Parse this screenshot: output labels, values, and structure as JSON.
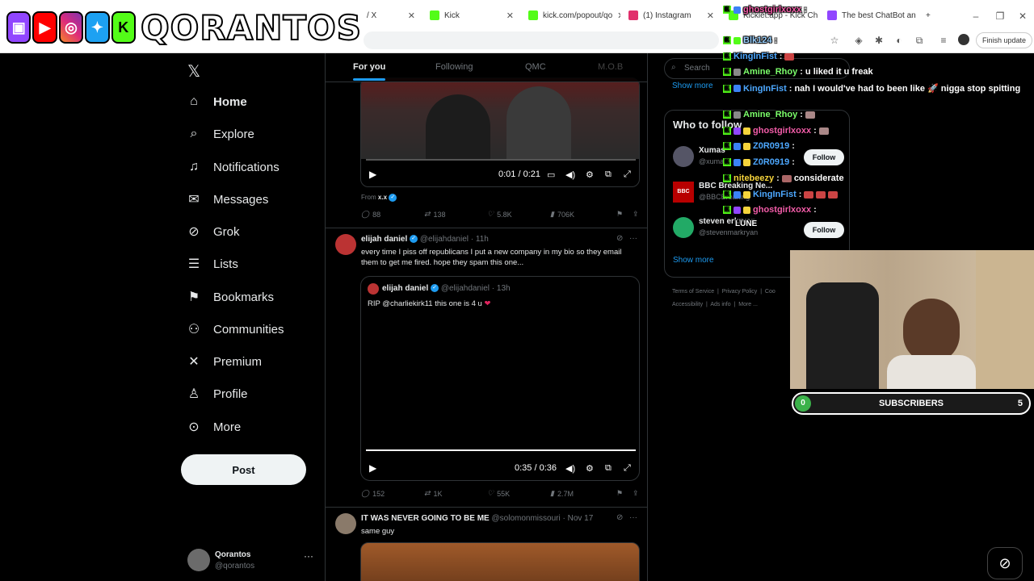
{
  "browser": {
    "tabs": [
      {
        "title": "/ X",
        "color": "#000000"
      },
      {
        "title": "Kick",
        "color": "#53fc18"
      },
      {
        "title": "kick.com/popout/qo",
        "color": "#53fc18"
      },
      {
        "title": "(1) Instagram",
        "color": "#e1306c"
      },
      {
        "title": "Kicklet.app - Kick Ch",
        "color": "#53fc18"
      },
      {
        "title": "The best ChatBot an",
        "color": "#9146ff"
      }
    ],
    "finish_update": "Finish update"
  },
  "banner": {
    "brand": "QORANTOS",
    "icons": [
      "twitch-icon",
      "youtube-icon",
      "instagram-icon",
      "twitter-icon",
      "kick-icon"
    ]
  },
  "nav": {
    "items": [
      {
        "label": "Home",
        "icon": "home-icon"
      },
      {
        "label": "Explore",
        "icon": "search-icon"
      },
      {
        "label": "Notifications",
        "icon": "bell-icon"
      },
      {
        "label": "Messages",
        "icon": "envelope-icon"
      },
      {
        "label": "Grok",
        "icon": "grok-icon"
      },
      {
        "label": "Lists",
        "icon": "list-icon"
      },
      {
        "label": "Bookmarks",
        "icon": "bookmark-icon"
      },
      {
        "label": "Communities",
        "icon": "people-icon"
      },
      {
        "label": "Premium",
        "icon": "x-icon"
      },
      {
        "label": "Profile",
        "icon": "person-icon"
      },
      {
        "label": "More",
        "icon": "more-circle-icon"
      }
    ],
    "post": "Post",
    "account": {
      "name": "Qorantos",
      "handle": "@qorantos"
    }
  },
  "feed": {
    "tabs": [
      "For you",
      "Following",
      "QMC",
      "M.O.B"
    ],
    "tweet1": {
      "video_time": "0:01 / 0:21",
      "from": "From",
      "from_handle": "x.x",
      "replies": "88",
      "reposts": "138",
      "likes": "5.8K",
      "views": "706K"
    },
    "tweet2": {
      "name": "elijah daniel",
      "handle": "@elijahdaniel",
      "time": "· 11h",
      "text": "every time I piss off republicans I put a new company in my bio so they email them to get me fired. hope they spam this one...",
      "quote": {
        "name": "elijah daniel",
        "handle": "@elijahdaniel",
        "time": "· 13h",
        "text": "RIP @charliekirk11 this one is 4 u"
      },
      "video_time": "0:35 / 0:36",
      "replies": "152",
      "reposts": "1K",
      "likes": "55K",
      "views": "2.7M"
    },
    "tweet3": {
      "name": "IT WAS NEVER GOING TO BE ME",
      "handle": "@solomonmissouri",
      "time": "· Nov 17",
      "text": "same guy"
    }
  },
  "right": {
    "search_placeholder": "Search",
    "show_more_top": "Show more",
    "who_to_follow": "Who to follow",
    "suggestions": [
      {
        "name": "Xumas",
        "handle": "@xuma",
        "button": "Follow"
      },
      {
        "name": "BBC Breaking Ne...",
        "handle": "@BBCBreaking",
        "button": ""
      },
      {
        "name": "steven erkryan",
        "handle": "@stevenmarkryan",
        "button": "Follow"
      }
    ],
    "show_more": "Show more",
    "footer": [
      "Terms of Service",
      "Privacy Policy",
      "Coo",
      "Accessibility",
      "Ads info",
      "More ..."
    ]
  },
  "chat": [
    {
      "user": "ghostgirlxoxx",
      "msg": "",
      "color": "#f25ca8"
    },
    {
      "user": "Blk124",
      "msg": "",
      "color": "#9ad1ff"
    },
    {
      "user": "KingInFist",
      "msg": "",
      "color": "#4da8ff"
    },
    {
      "user": "Amine_Rhoy",
      "msg": "u liked it u freak",
      "color": "#7cff6b"
    },
    {
      "user": "KingInFist",
      "msg": "nah I would've had to been like 🚀 nigga stop spitting",
      "color": "#4da8ff"
    },
    {
      "user": "Amine_Rhoy",
      "msg": "",
      "color": "#7cff6b"
    },
    {
      "user": "ghostgirlxoxx",
      "msg": "",
      "color": "#f25ca8"
    },
    {
      "user": "Z0R0919",
      "msg": "",
      "color": "#4da8ff"
    },
    {
      "user": "Z0R0919",
      "msg": "",
      "color": "#4da8ff"
    },
    {
      "user": "nitebeezy",
      "msg": "considerate",
      "color": "#f5d33b"
    },
    {
      "user": "KingInFist",
      "msg": "",
      "color": "#4da8ff"
    },
    {
      "user": "ghostgirlxoxx",
      "msg": "",
      "color": "#f25ca8"
    },
    {
      "user": "LUNE",
      "msg": "",
      "color": "#ffffff"
    }
  ],
  "subscribers": {
    "left": "0",
    "label": "SUBSCRIBERS",
    "right": "5"
  }
}
